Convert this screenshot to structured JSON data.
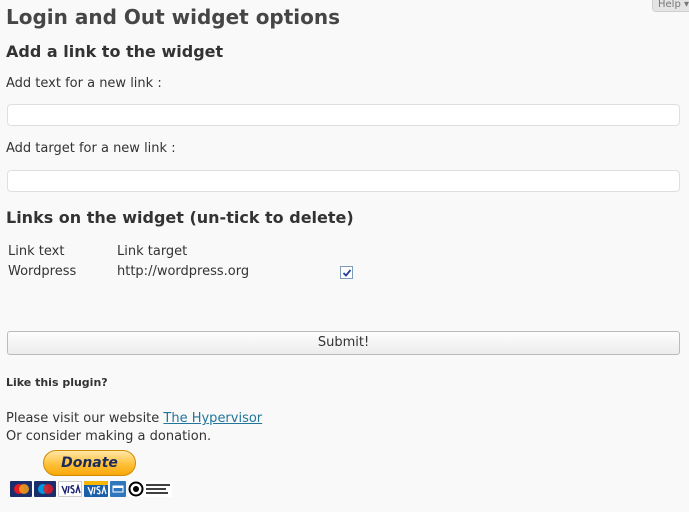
{
  "help_tab": "Help ▾",
  "page_title": "Login and Out widget options",
  "add_section": {
    "heading": "Add a link to the widget",
    "text_label": "Add text for a new link :",
    "text_value": "",
    "target_label": "Add target for a new link :",
    "target_value": ""
  },
  "links_section": {
    "heading": "Links on the widget (un-tick to delete)",
    "columns": {
      "text": "Link text",
      "target": "Link target"
    },
    "rows": [
      {
        "text": "Wordpress",
        "target": "http://wordpress.org",
        "checked": true
      }
    ]
  },
  "submit_label": "Submit!",
  "promo": {
    "like_heading": "Like this plugin?",
    "visit_text": "Please visit our website ",
    "visit_link": "The Hypervisor",
    "donation_text": "Or consider making a donation.",
    "donate_label": "Donate"
  },
  "payment_cards": [
    "mastercard-icon",
    "maestro-icon",
    "visa-icon",
    "visa-electron-icon",
    "amex-icon",
    "direct-debit-icon"
  ],
  "colors": {
    "background": "#f9f9f9",
    "link": "#21759b",
    "donate": "#ffc13a"
  }
}
